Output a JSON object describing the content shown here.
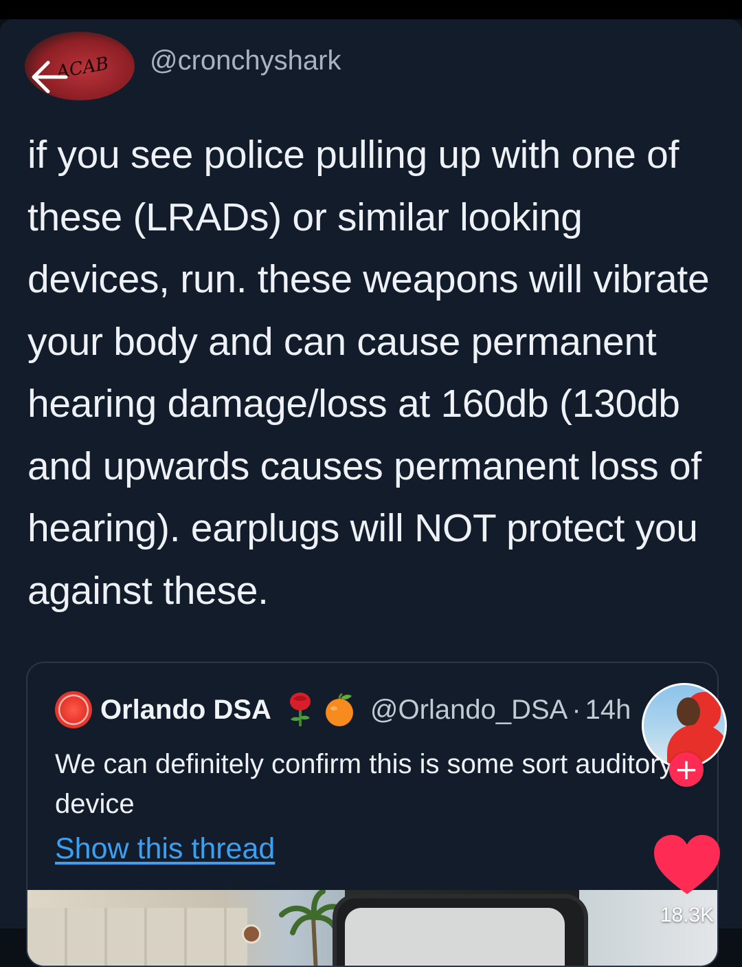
{
  "tweet": {
    "avatar_text": "ACAB",
    "handle": "@cronchyshark",
    "body": "if you see police pulling up with one of these (LRADs) or similar looking devices, run. these weapons will vibrate your body and can cause permanent hearing damage/loss at 160db (130db and upwards causes permanent loss of hearing). earplugs will NOT protect you against these."
  },
  "quoted_tweet": {
    "name": "Orlando DSA",
    "handle": "@Orlando_DSA",
    "separator": "·",
    "time": "14h",
    "text": "We can definitely confirm this is some sort auditory device",
    "show_thread_label": "Show this thread"
  },
  "overlay": {
    "follow_label": "+",
    "like_count": "18.3K"
  },
  "colors": {
    "background": "#131c2b",
    "link": "#3aa0f2",
    "tiktok_red": "#fe2c55"
  },
  "icons": [
    "back-arrow-icon",
    "rose-emoji-icon",
    "orange-emoji-icon",
    "heart-icon"
  ]
}
